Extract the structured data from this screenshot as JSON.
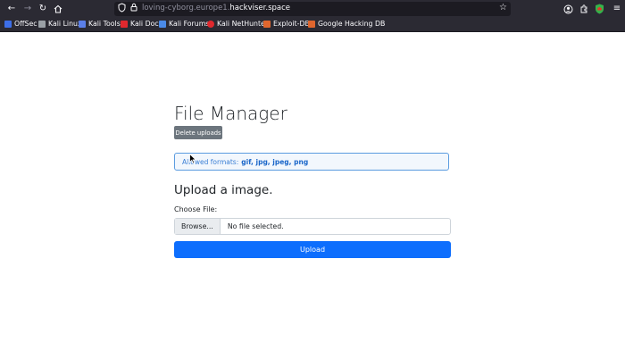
{
  "browser": {
    "url_prefix": "loving-cyborg.europe1.",
    "url_host": "hackviser.space",
    "bookmarks": [
      {
        "label": "OffSec",
        "color": "#3d6ee8"
      },
      {
        "label": "Kali Linux",
        "color": "#9aa0a6"
      },
      {
        "label": "Kali Tools",
        "color": "#5b7fe8"
      },
      {
        "label": "Kali Docs",
        "color": "#e0282e"
      },
      {
        "label": "Kali Forums",
        "color": "#4a8ae8"
      },
      {
        "label": "Kali NetHunter",
        "color": "#e0282e"
      },
      {
        "label": "Exploit-DB",
        "color": "#e0662e"
      },
      {
        "label": "Google Hacking DB",
        "color": "#e0662e"
      }
    ]
  },
  "page": {
    "title": "File Manager",
    "delete_button": "Delete uploads",
    "alert_prefix": "Allowed formats:",
    "alert_formats": "gif, jpg, jpeg, png",
    "upload_heading": "Upload a image.",
    "file_label": "Choose File:",
    "browse_button": "Browse...",
    "file_status": "No file selected.",
    "upload_button": "Upload"
  },
  "colors": {
    "chrome_bg": "#2b2a33",
    "primary": "#0d6efd",
    "secondary": "#6c757d",
    "alert_border": "#5b9ce0"
  }
}
